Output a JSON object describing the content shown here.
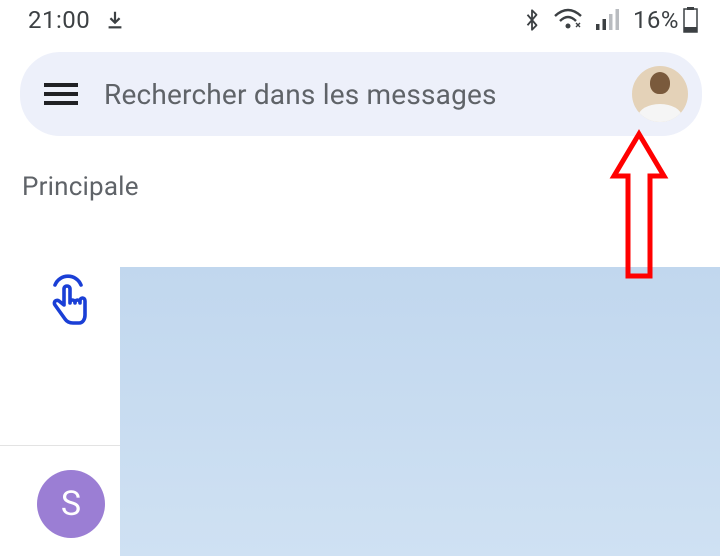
{
  "status_bar": {
    "time": "21:00",
    "battery_text": "16%"
  },
  "search": {
    "placeholder": "Rechercher dans les messages"
  },
  "section": {
    "label": "Principale"
  },
  "list": {
    "item2_initial": "S"
  }
}
